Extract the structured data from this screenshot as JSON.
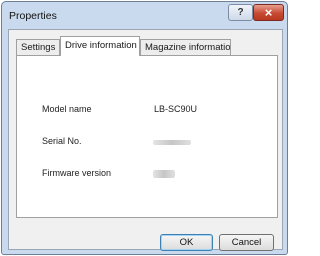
{
  "window": {
    "title": "Properties"
  },
  "titlebar": {
    "help_glyph": "?",
    "close_glyph": "×"
  },
  "tabs": [
    {
      "label": "Settings",
      "active": false
    },
    {
      "label": "Drive information",
      "active": true
    },
    {
      "label": "Magazine information",
      "active": false
    }
  ],
  "drive_info": {
    "model_name_label": "Model name",
    "model_name_value": "LB-SC90U",
    "serial_label": "Serial No.",
    "firmware_label": "Firmware version"
  },
  "buttons": {
    "ok": "OK",
    "cancel": "Cancel"
  },
  "colors": {
    "close_button": "#c74a33",
    "titlebar": "#c9daee"
  }
}
